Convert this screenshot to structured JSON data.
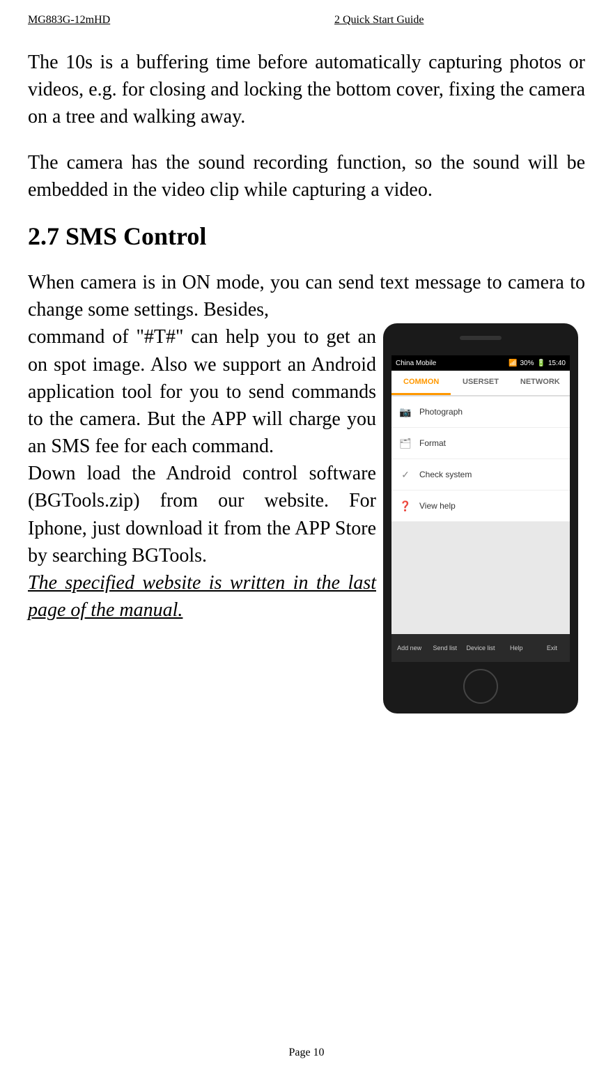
{
  "header": {
    "left": "MG883G-12mHD",
    "right": "2 Quick Start Guide"
  },
  "paragraphs": {
    "p1": "The 10s is a buffering time before automatically capturing photos or videos, e.g. for closing and locking the bottom cover, fixing the camera on a tree and walking away.",
    "p2": "The camera has the sound recording function, so the sound will be embedded in the video clip while capturing a video."
  },
  "section_title": "2.7 SMS Control",
  "section_intro": "When camera is in ON mode, you can send text message to camera to change some settings. Besides,",
  "section_col": {
    "p1": "command of \"#T#\" can help you to get an on spot image. Also we support an Android application tool for you to send commands to the camera. But the APP will charge you an SMS fee for each command.",
    "p2": "Down load the Android control software (BGTools.zip) from our website. For Iphone, just download it from the APP Store by searching BGTools.",
    "p3": "The specified website is written in the last page of the manual."
  },
  "phone": {
    "carrier": "China Mobile",
    "battery": "30%",
    "time": "15:40",
    "tabs": [
      "COMMON",
      "USERSET",
      "NETWORK"
    ],
    "menu": [
      "Photograph",
      "Format",
      "Check system",
      "View help"
    ],
    "bottom_bar": [
      "Add new",
      "Send list",
      "Device list",
      "Help",
      "Exit"
    ]
  },
  "footer": "Page 10"
}
